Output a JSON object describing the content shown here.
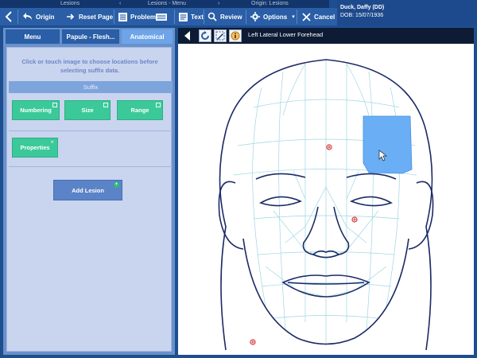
{
  "titlebar": {
    "lesions_left": "Lesions",
    "lesions_menu": "Lesions - Menu",
    "origin": "Origin: Lesions"
  },
  "toolbar": {
    "origin": "Origin",
    "reset_page": "Reset Page",
    "problem": "Problem",
    "text": "Text",
    "review": "Review",
    "options": "Options",
    "cancel": "Cancel"
  },
  "patient": {
    "name": "Duck, Daffy (DD)",
    "dob": "DOB:   15/07/1936"
  },
  "left_panel": {
    "tabs": [
      "Menu",
      "Papule - Flesh...",
      "Anatomical"
    ],
    "hint": "Click or touch image to choose locations before selecting suffix data.",
    "suffix": "Suffix",
    "buttons": [
      "Numbering",
      "Size",
      "Range"
    ],
    "properties": "Properties",
    "add_lesion": "Add Lesion"
  },
  "right_panel": {
    "location_title": "Left Lateral Lower Forehead"
  },
  "colors": {
    "accent": "#2a5ea6",
    "highlight_region": "#6aaef5",
    "marker": "#d23a3a",
    "face_outline": "#1b2a66",
    "mesh": "#8fd0e0"
  }
}
